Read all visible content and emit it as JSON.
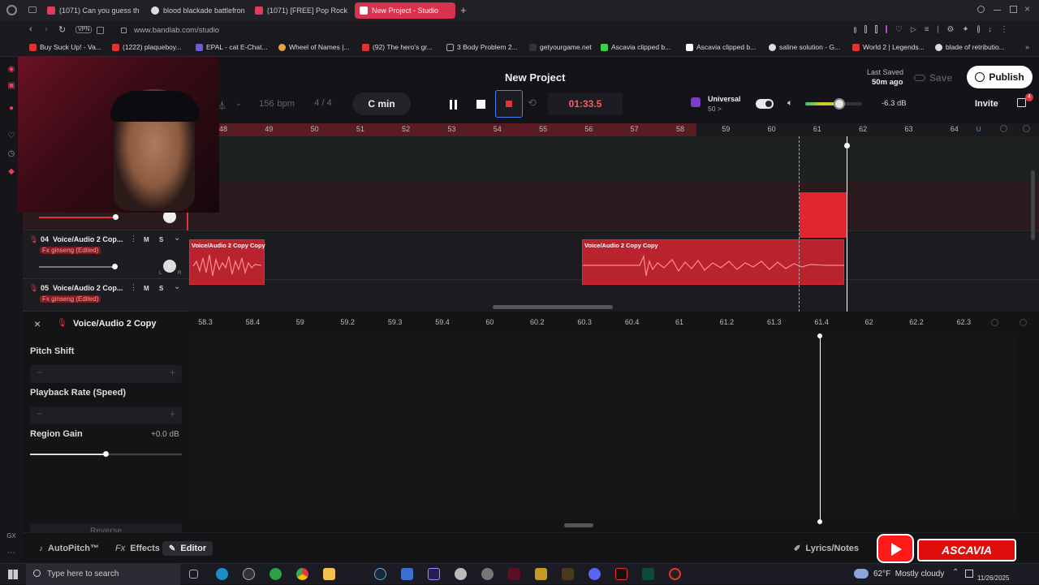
{
  "browser": {
    "tabs": [
      {
        "title": "(1071) Can you guess the"
      },
      {
        "title": "blood blackade battlefron"
      },
      {
        "title": "(1071) [FREE] Pop Rock x"
      },
      {
        "title": "New Project - Studio",
        "active": true
      }
    ],
    "vpn_label": "VPN",
    "url": "www.bandlab.com/studio",
    "bookmarks": [
      "Buy Suck Up! - Va...",
      "(1222) plaqueboy...",
      "EPAL - cat E-Chat...",
      "Wheel of Names |...",
      "(92) The hero's gr...",
      "3 Body Problem 2...",
      "getyourgame.net",
      "Ascavia clipped b...",
      "Ascavia clipped b...",
      "saline solution - G...",
      "World 2 | Legends...",
      "blade of retributio..."
    ],
    "extension_badge": "4"
  },
  "studio": {
    "project_title": "New Project",
    "last_saved_label": "Last Saved",
    "last_saved_time": "50m ago",
    "save_label": "Save",
    "publish_label": "Publish",
    "invite_label": "Invite",
    "bpm_value": "156",
    "bpm_unit": "bpm",
    "time_signature": "4 / 4",
    "key": "C min",
    "time_display": "01:33.5",
    "preset_name": "Universal",
    "preset_sub": "50 >",
    "master_volume": "-6.3 dB",
    "master_volume_level": 0.6,
    "ruler": [
      "48",
      "49",
      "50",
      "51",
      "52",
      "53",
      "54",
      "55",
      "56",
      "57",
      "58",
      "59",
      "60",
      "61",
      "62",
      "63",
      "64"
    ],
    "tracks": [
      {
        "number": "04",
        "name": "Voice/Audio 2 Cop...",
        "fx": "Fx ginseng (Edited)",
        "mute": "M",
        "solo": "S"
      },
      {
        "number": "05",
        "name": "Voice/Audio 2 Cop...",
        "fx": "Fx ginseng (Edited)",
        "mute": "M",
        "solo": "S"
      }
    ],
    "pan_l": "L",
    "pan_r": "R",
    "region_label_1": "Voice/Audio 2 Copy Copy",
    "region_label_2": "Voice/Audio 2 Copy Copy",
    "editor": {
      "title": "Voice/Audio 2 Copy",
      "pitch_shift_label": "Pitch Shift",
      "playback_rate_label": "Playback Rate (Speed)",
      "region_gain_label": "Region Gain",
      "region_gain_value": "+0.0 dB",
      "reverse_label": "Reverse",
      "minus": "−",
      "plus": "+",
      "subruler": [
        "58.3",
        "58.4",
        "59",
        "59.2",
        "59.3",
        "59.4",
        "60",
        "60.2",
        "60.3",
        "60.4",
        "61",
        "61.2",
        "61.3",
        "61.4",
        "62",
        "62.2",
        "62.3"
      ]
    },
    "bottom_tabs": {
      "autopitch": "AutoPitch™",
      "effects_prefix": "Fx",
      "effects": "Effects",
      "editor": "Editor",
      "lyrics": "Lyrics/Notes"
    }
  },
  "overlay": {
    "brand": "ASCAVIA"
  },
  "taskbar": {
    "search_placeholder": "Type here to search",
    "weather": "62°F  Mostly cloudy",
    "date": "11/26/2025"
  }
}
